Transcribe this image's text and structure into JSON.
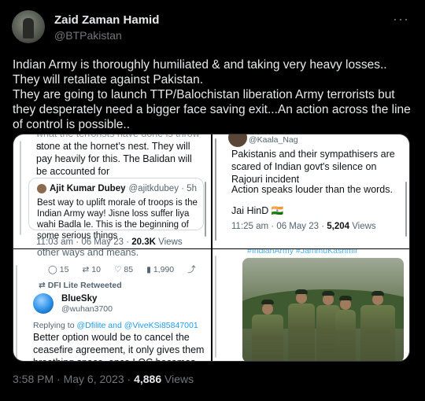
{
  "author": {
    "name": "Zaid Zaman Hamid",
    "handle": "@BTPakistan"
  },
  "more_icon": "more-horizontal-icon",
  "tweet_text": [
    "Indian Army is thoroughly humiliated & and taking very heavy losses..",
    "They will retaliate against Pakistan.",
    "They are going to launch TTP/Balochistan liberation Army terrorists but they desperately need a bigger face saving exit...An action across the line of control is possible.."
  ],
  "media": {
    "q1": {
      "text": "stone at the hornet’s nest. They will pay heavily for this. The Balidan will be accounted for",
      "partial_top": "what the terrorists have done is throw a",
      "quote_author": "Ajit Kumar Dubey",
      "quote_handle": "@ajitkdubey · 5h",
      "quote_text": "Best way to uplift morale of troops is  the Indian Army way! Jisne loss suffer liya wahi Badla le. This is the beginning of some serious things",
      "time": "11:03 am · 06 May 23 · ",
      "views_count": "20.3K",
      "views_label": " Views"
    },
    "q2": {
      "handle": "@Kaala_Nag",
      "text": "Pakistanis and their sympathisers are scared of Indian govt's silence on Rajouri incident",
      "text2": "Action speaks louder than the words.",
      "text3": "Jai HinD 🇮🇳",
      "time": "11:25 am · 06 May 23 · ",
      "views_count": "5,204",
      "views_label": " Views"
    },
    "q3": {
      "partial_top": "other ways and means.",
      "replies": "15",
      "retweets": "10",
      "likes": "85",
      "views": "1,990",
      "retweeted_by": "DFI Lite Retweeted",
      "user_name": "BlueSky",
      "user_handle": "@wuhan3700",
      "reply_prefix": "Replying to ",
      "reply_to": "@Dfilite and @ViveKSi85847001",
      "text": "Better option would be to cancel the ceasefire agreement, it only gives them breathing space, once LOC becomes hot"
    },
    "q4": {
      "hashtags": "#IndianArmy #JammuKashmir"
    }
  },
  "footer": {
    "time": "3:58 PM · May 6, 2023 · ",
    "views_count": "4,886",
    "views_label": " Views"
  }
}
